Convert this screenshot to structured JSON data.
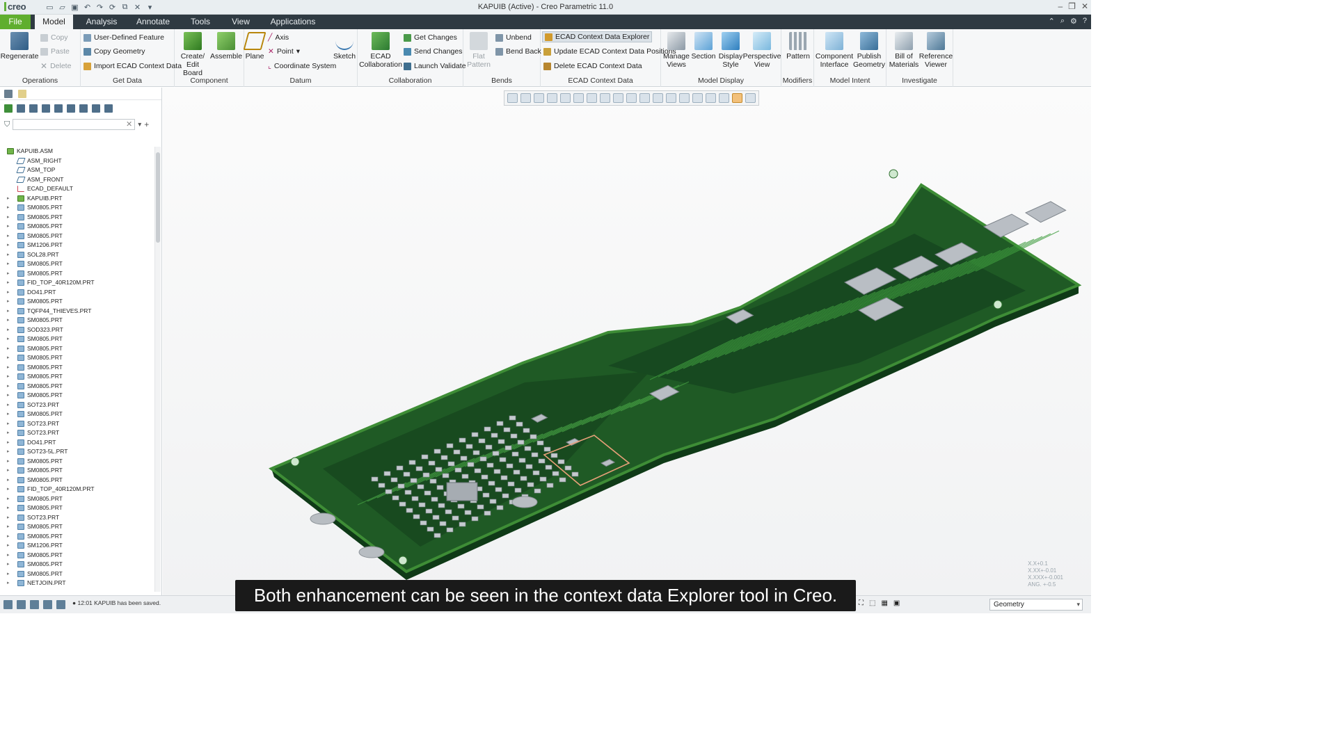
{
  "app": {
    "logo": "creo",
    "title": "KAPUIB (Active) - Creo Parametric 11.0"
  },
  "quick_access": [
    "new-icon",
    "open-icon",
    "save-icon",
    "undo-icon",
    "redo-icon",
    "regenerate-icon",
    "windows-icon",
    "close-icon",
    "customize-icon"
  ],
  "tabs": [
    "File",
    "Model",
    "Analysis",
    "Annotate",
    "Tools",
    "View",
    "Applications"
  ],
  "ribbon": {
    "operations": {
      "label": "Operations",
      "regenerate": "Regenerate",
      "copy": "Copy",
      "paste": "Paste",
      "delete": "Delete"
    },
    "get_data": {
      "label": "Get Data",
      "udf": "User-Defined Feature",
      "copy_geom": "Copy Geometry",
      "import_ecad": "Import ECAD Context Data"
    },
    "component": {
      "label": "Component",
      "create": "Create/\nEdit Board",
      "assemble": "Assemble"
    },
    "datum": {
      "label": "Datum",
      "plane": "Plane",
      "axis": "Axis",
      "point": "Point",
      "csys": "Coordinate System",
      "sketch": "Sketch"
    },
    "collaboration": {
      "label": "Collaboration",
      "ecad": "ECAD\nCollaboration",
      "get": "Get Changes",
      "send": "Send Changes",
      "validate": "Launch Validate"
    },
    "bends": {
      "label": "Bends",
      "flat": "Flat\nPattern",
      "unbend": "Unbend",
      "bendback": "Bend Back"
    },
    "ecad_context": {
      "label": "ECAD Context Data",
      "explorer": "ECAD Context Data Explorer",
      "update": "Update ECAD Context Data Positions",
      "delete": "Delete ECAD Context Data"
    },
    "model_display": {
      "label": "Model Display",
      "manage": "Manage\nViews",
      "section": "Section",
      "display": "Display\nStyle",
      "persp": "Perspective\nView"
    },
    "modifiers": {
      "label": "Modifiers",
      "pattern": "Pattern"
    },
    "model_intent": {
      "label": "Model Intent",
      "comp_if": "Component\nInterface",
      "publish": "Publish\nGeometry"
    },
    "investigate": {
      "label": "Investigate",
      "bom": "Bill of\nMaterials",
      "refviewer": "Reference\nViewer"
    }
  },
  "tree": {
    "filter_placeholder": "",
    "items": [
      {
        "name": "KAPUIB.ASM",
        "type": "asm",
        "expand": false
      },
      {
        "name": "ASM_RIGHT",
        "type": "datum",
        "expand": false
      },
      {
        "name": "ASM_TOP",
        "type": "datum",
        "expand": false
      },
      {
        "name": "ASM_FRONT",
        "type": "datum",
        "expand": false
      },
      {
        "name": "ECAD_DEFAULT",
        "type": "csys",
        "expand": false
      },
      {
        "name": "KAPUIB.PRT",
        "type": "asm",
        "expand": true
      },
      {
        "name": "SM0805.PRT",
        "type": "part",
        "expand": true
      },
      {
        "name": "SM0805.PRT",
        "type": "part",
        "expand": true
      },
      {
        "name": "SM0805.PRT",
        "type": "part",
        "expand": true
      },
      {
        "name": "SM0805.PRT",
        "type": "part",
        "expand": true
      },
      {
        "name": "SM1206.PRT",
        "type": "part",
        "expand": true
      },
      {
        "name": "SOL28.PRT",
        "type": "part",
        "expand": true
      },
      {
        "name": "SM0805.PRT",
        "type": "part",
        "expand": true
      },
      {
        "name": "SM0805.PRT",
        "type": "part",
        "expand": true
      },
      {
        "name": "FID_TOP_40R120M.PRT",
        "type": "part",
        "expand": true
      },
      {
        "name": "DO41.PRT",
        "type": "part",
        "expand": true
      },
      {
        "name": "SM0805.PRT",
        "type": "part",
        "expand": true
      },
      {
        "name": "TQFP44_THIEVES.PRT",
        "type": "part",
        "expand": true
      },
      {
        "name": "SM0805.PRT",
        "type": "part",
        "expand": true
      },
      {
        "name": "SOD323.PRT",
        "type": "part",
        "expand": true
      },
      {
        "name": "SM0805.PRT",
        "type": "part",
        "expand": true
      },
      {
        "name": "SM0805.PRT",
        "type": "part",
        "expand": true
      },
      {
        "name": "SM0805.PRT",
        "type": "part",
        "expand": true
      },
      {
        "name": "SM0805.PRT",
        "type": "part",
        "expand": true
      },
      {
        "name": "SM0805.PRT",
        "type": "part",
        "expand": true
      },
      {
        "name": "SM0805.PRT",
        "type": "part",
        "expand": true
      },
      {
        "name": "SM0805.PRT",
        "type": "part",
        "expand": true
      },
      {
        "name": "SOT23.PRT",
        "type": "part",
        "expand": true
      },
      {
        "name": "SM0805.PRT",
        "type": "part",
        "expand": true
      },
      {
        "name": "SOT23.PRT",
        "type": "part",
        "expand": true
      },
      {
        "name": "SOT23.PRT",
        "type": "part",
        "expand": true
      },
      {
        "name": "DO41.PRT",
        "type": "part",
        "expand": true
      },
      {
        "name": "SOT23-5L.PRT",
        "type": "part",
        "expand": true
      },
      {
        "name": "SM0805.PRT",
        "type": "part",
        "expand": true
      },
      {
        "name": "SM0805.PRT",
        "type": "part",
        "expand": true
      },
      {
        "name": "SM0805.PRT",
        "type": "part",
        "expand": true
      },
      {
        "name": "FID_TOP_40R120M.PRT",
        "type": "part",
        "expand": true
      },
      {
        "name": "SM0805.PRT",
        "type": "part",
        "expand": true
      },
      {
        "name": "SM0805.PRT",
        "type": "part",
        "expand": true
      },
      {
        "name": "SOT23.PRT",
        "type": "part",
        "expand": true
      },
      {
        "name": "SM0805.PRT",
        "type": "part",
        "expand": true
      },
      {
        "name": "SM0805.PRT",
        "type": "part",
        "expand": true
      },
      {
        "name": "SM1206.PRT",
        "type": "part",
        "expand": true
      },
      {
        "name": "SM0805.PRT",
        "type": "part",
        "expand": true
      },
      {
        "name": "SM0805.PRT",
        "type": "part",
        "expand": true
      },
      {
        "name": "SM0805.PRT",
        "type": "part",
        "expand": true
      },
      {
        "name": "NETJOIN.PRT",
        "type": "part",
        "expand": true
      }
    ]
  },
  "viewport": {
    "coords": [
      "X.X+0.1",
      "X.XX+-0.01",
      "X.XXX+-0.001",
      "ANG. +-0.5"
    ]
  },
  "caption": "Both enhancement can be seen in the context data Explorer tool in Creo.",
  "status": {
    "message": "12:01 KAPUIB has been saved.",
    "filter": "Geometry"
  },
  "colors": {
    "accent": "#5fae2e",
    "tabbar": "#2f3a42",
    "pcb": "#1f5a25",
    "pcb_edge": "#3e8d36",
    "chip": "#b9bec4"
  }
}
